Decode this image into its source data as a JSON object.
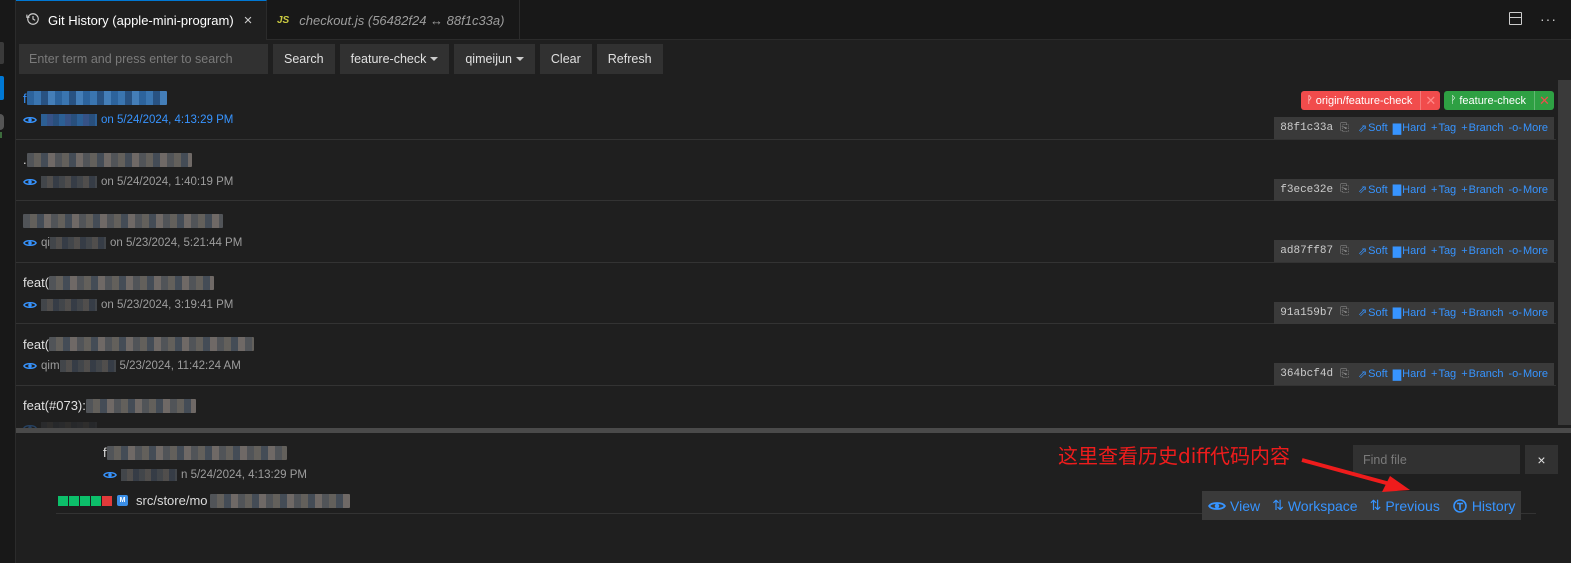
{
  "tabs": [
    {
      "label": "Git History (apple-mini-program)",
      "icon": "history-icon",
      "active": true,
      "close": "×"
    },
    {
      "label": "checkout.js (56482f24 ↔ 88f1c33a)",
      "icon": "js-file-icon",
      "badge": "JS",
      "active": false
    }
  ],
  "toolbar": {
    "search_placeholder": "Enter term and press enter to search",
    "search_label": "Search",
    "branch_label": "feature-check",
    "author_label": "qimeijun",
    "clear_label": "Clear",
    "refresh_label": "Refresh"
  },
  "commits": [
    {
      "message_prefix": "f",
      "message_obscured": true,
      "author_prefix": "",
      "date_text": "on 5/24/2024, 4:13:29 PM",
      "hash": "88f1c33a",
      "refs": [
        {
          "label": "origin/feature-check",
          "type": "remote",
          "color": "#f14c4c"
        },
        {
          "label": "feature-check",
          "type": "local",
          "color": "#2ea043"
        }
      ]
    },
    {
      "message_prefix": ".",
      "message_obscured": true,
      "author_prefix": "",
      "date_text": "on 5/24/2024, 1:40:19 PM",
      "hash": "f3ece32e",
      "refs": []
    },
    {
      "message_prefix": "",
      "message_obscured": true,
      "author_prefix": "qi",
      "date_text": "on 5/23/2024, 5:21:44 PM",
      "hash": "ad87ff87",
      "refs": []
    },
    {
      "message_prefix": "feat(",
      "message_obscured": true,
      "author_prefix": "",
      "date_text": "on 5/23/2024, 3:19:41 PM",
      "hash": "91a159b7",
      "refs": []
    },
    {
      "message_prefix": "feat(",
      "message_obscured": true,
      "author_prefix": "qim",
      "date_text": "5/23/2024, 11:42:24 AM",
      "hash": "364bcf4d",
      "refs": []
    },
    {
      "message_prefix": "feat(#073): ",
      "message_obscured": true,
      "author_prefix": "",
      "date_text": "",
      "hash": "",
      "refs": []
    }
  ],
  "commit_actions": {
    "soft": "Soft",
    "hard": "Hard",
    "tag": "Tag",
    "branch": "Branch",
    "more": "More"
  },
  "detail": {
    "message_prefix": "f",
    "date_text": "n 5/24/2024, 4:13:29 PM",
    "file": {
      "status": "M",
      "path": "src/store/mo",
      "path_obscured": true,
      "stat": {
        "additions_blocks": 4,
        "deletions_blocks": 1
      }
    },
    "find_placeholder": "Find file",
    "find_close": "×",
    "actions": {
      "view": "View",
      "workspace": "Workspace",
      "previous": "Previous",
      "history": "History"
    }
  },
  "annotation": {
    "text": "这里查看历史diff代码内容",
    "color": "#ee1c1c"
  },
  "colors": {
    "accent": "#3794ff",
    "remote_ref": "#f14c4c",
    "local_ref": "#2ea043",
    "active_tab_border": "#0078d4"
  }
}
